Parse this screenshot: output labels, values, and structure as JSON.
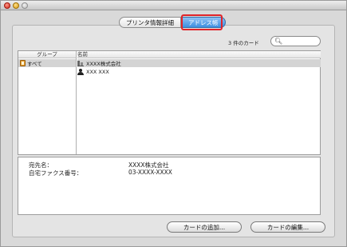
{
  "tabs": [
    {
      "label": "プリンタ情報詳細"
    },
    {
      "label": "アドレス帳"
    }
  ],
  "card_count": "3 件のカード",
  "columns": {
    "group": "グループ",
    "name": "名前"
  },
  "groups": [
    {
      "label": "すべて"
    }
  ],
  "entries": [
    {
      "label": "XXXX株式会社",
      "icon": "company-icon"
    },
    {
      "label": "XXX XXX",
      "icon": "person-icon"
    }
  ],
  "detail": {
    "fields": [
      {
        "label": "宛先名：",
        "value": "XXXX株式会社"
      },
      {
        "label": "自宅ファクス番号：",
        "value": "03-XXXX-XXXX"
      }
    ]
  },
  "buttons": {
    "add": "カードの追加...",
    "edit": "カードの編集..."
  }
}
